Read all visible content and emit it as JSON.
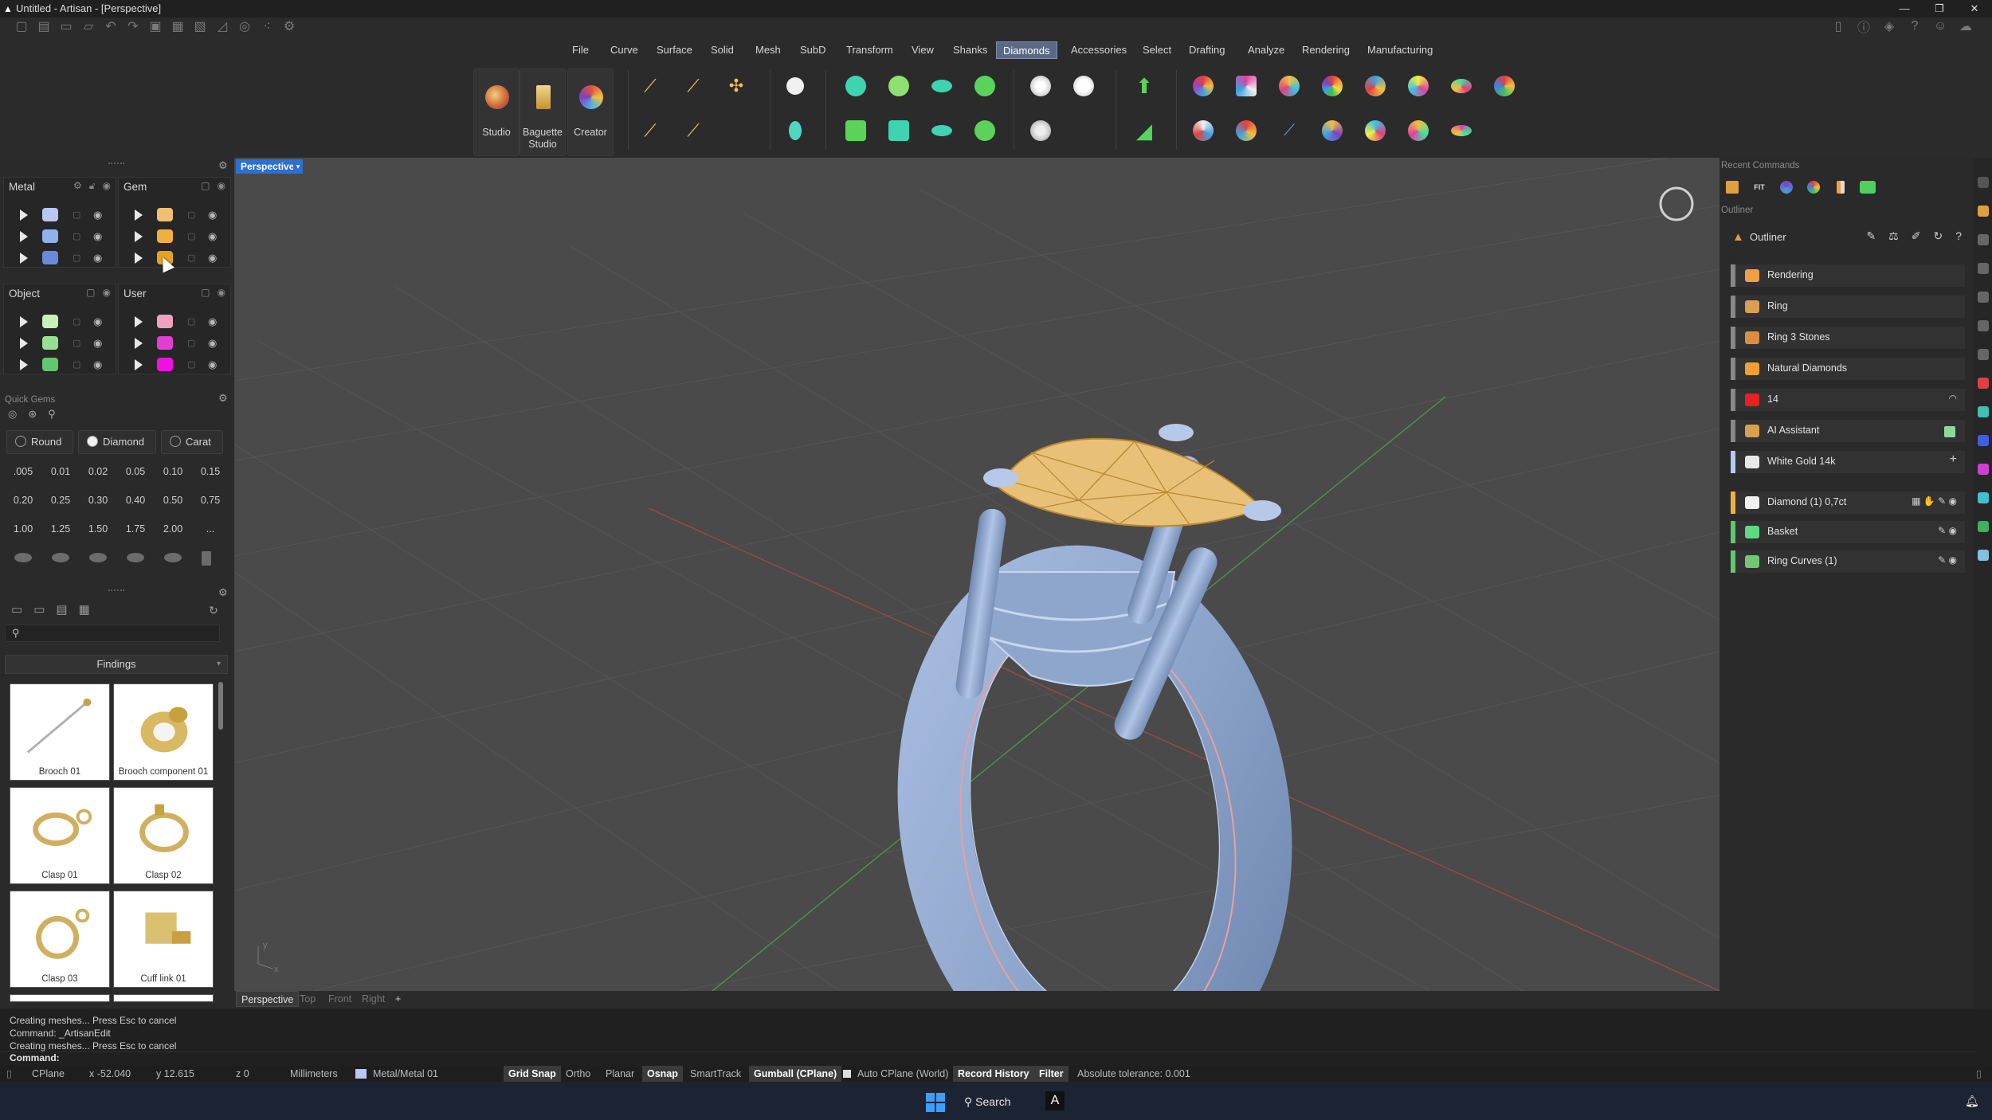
{
  "window": {
    "title": "Untitled - Artisan - [Perspective]",
    "app_icon": "artisan-logo-icon",
    "controls": [
      "—",
      "❐",
      "✕"
    ]
  },
  "quick_access": [
    "new-file-icon",
    "new-template-icon",
    "open-icon",
    "open-folder-icon",
    "undo-icon",
    "redo-icon",
    "save-icon",
    "save-as-icon",
    "save-all-icon",
    "draw-curve-icon",
    "draw-shape-icon",
    "points-icon",
    "gear-tool-icon"
  ],
  "top_right_icons": [
    "app-icon",
    "info-icon",
    "layers-icon",
    "help-icon",
    "users-icon",
    "cloud-icon"
  ],
  "menu": {
    "items": [
      "File",
      "Curve",
      "Surface",
      "Solid",
      "Mesh",
      "SubD",
      "Transform",
      "View",
      "Shanks",
      "Diamonds",
      "Accessories",
      "Select",
      "Drafting",
      "Analyze",
      "Rendering",
      "Manufacturing"
    ],
    "active": "Diamonds"
  },
  "ribbon": {
    "big_buttons": [
      {
        "label": "Studio",
        "color": "#e0a040"
      },
      {
        "label": "Baguette Studio",
        "color": "#e8c070"
      },
      {
        "label": "Creator",
        "color": "#d86048"
      }
    ],
    "icon_colors": {
      "teal": "#3fd3b0",
      "green": "#5bd35b",
      "orange": "#f0a030",
      "white": "#f0f0f0",
      "rainbow": "#b080e0"
    }
  },
  "layers": {
    "metal": {
      "title": "Metal",
      "colors": [
        "#b8c8f0",
        "#90b0ee",
        "#6a8ad8"
      ]
    },
    "gem": {
      "title": "Gem",
      "colors": [
        "#f0c070",
        "#f0b040",
        "#e8a020"
      ]
    },
    "object": {
      "title": "Object",
      "colors": [
        "#c8f0b8",
        "#98e090",
        "#60c870"
      ]
    },
    "user": {
      "title": "User",
      "colors": [
        "#f0a0c0",
        "#e040d0",
        "#f010e0"
      ]
    }
  },
  "quick_gems": {
    "title": "Quick Gems",
    "shape": "Round",
    "material": "Diamond",
    "unit": "Carat",
    "sizes": [
      ".005",
      "0.01",
      "0.02",
      "0.05",
      "0.10",
      "0.15",
      "0.20",
      "0.25",
      "0.30",
      "0.40",
      "0.50",
      "0.75",
      "1.00",
      "1.25",
      "1.50",
      "1.75",
      "2.00",
      "..."
    ]
  },
  "library": {
    "search_placeholder": "",
    "category": "Findings",
    "items": [
      {
        "label": "Brooch 01"
      },
      {
        "label": "Brooch component 01"
      },
      {
        "label": "Clasp 01"
      },
      {
        "label": "Clasp 02"
      },
      {
        "label": "Clasp 03"
      },
      {
        "label": "Cuff link 01"
      }
    ]
  },
  "viewport": {
    "active_tab": "Perspective",
    "tabs": [
      "Perspective",
      "Top",
      "Front",
      "Right",
      "+"
    ],
    "colors": {
      "metal": "#8fa6cc",
      "gem": "#e8c078",
      "grid": "#555555",
      "curve": "#e8a0a0"
    },
    "axis_y": "y",
    "axis_x": "x"
  },
  "recent_commands": {
    "title": "Recent Commands",
    "fit_label": "FIT",
    "icons": [
      "layers-icon",
      "fit-icon",
      "color-wheel-icon",
      "rainbow-icon",
      "split-icon",
      "green-box-icon"
    ]
  },
  "outliner": {
    "section_title": "Outliner",
    "header": "Outliner",
    "rows": [
      {
        "label": "Rendering",
        "icon_color": "#f0a040",
        "bar": "#888888"
      },
      {
        "label": "Ring",
        "icon_color": "#d8a050",
        "bar": "#888888"
      },
      {
        "label": "Ring 3 Stones",
        "icon_color": "#d89040",
        "bar": "#888888"
      },
      {
        "label": "Natural Diamonds",
        "icon_color": "#f0a030",
        "bar": "#888888"
      },
      {
        "label": "14",
        "icon_color": "#e82020",
        "bar": "#888888"
      },
      {
        "label": "AI Assistant",
        "icon_color": "#d8a050",
        "bar": "#888888"
      },
      {
        "label": "White Gold 14k",
        "icon_color": "#e8e8e8",
        "bar": "#b8c8f0"
      },
      {
        "label": "Diamond (1) 0,7ct",
        "icon_color": "#f0f0f0",
        "bar": "#f0b040"
      },
      {
        "label": "Basket",
        "icon_color": "#60d880",
        "bar": "#60c870"
      },
      {
        "label": "Ring Curves (1)",
        "icon_color": "#70c870",
        "bar": "#60c870"
      }
    ]
  },
  "command_history": [
    "Creating meshes... Press Esc to cancel",
    "Command: _ArtisanEdit",
    "Creating meshes... Press Esc to cancel"
  ],
  "command_prompt": "Command:",
  "status": {
    "cplane": "CPlane",
    "x": "x -52.040",
    "y": "y 12.615",
    "z": "z 0",
    "units": "Millimeters",
    "layer": "Metal/Metal 01",
    "grid_snap": "Grid Snap",
    "ortho": "Ortho",
    "planar": "Planar",
    "osnap": "Osnap",
    "smarttrack": "SmartTrack",
    "gumball": "Gumball (CPlane)",
    "auto_cplane": "Auto CPlane (World)",
    "record_history": "Record History",
    "filter": "Filter",
    "tolerance": "Absolute tolerance: 0.001"
  },
  "taskbar": {
    "search": "Search",
    "app_letter": "A"
  }
}
